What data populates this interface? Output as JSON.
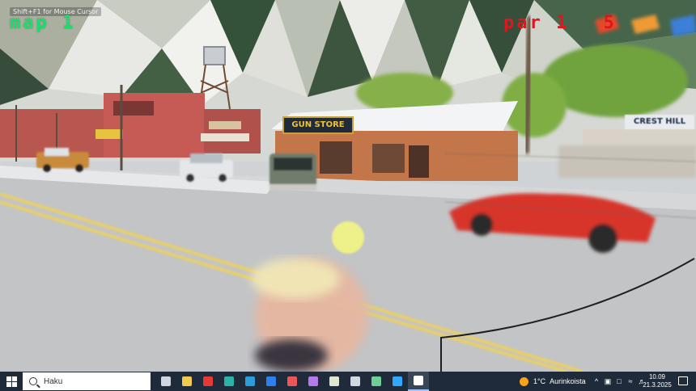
{
  "hud": {
    "map_label": "map 1",
    "par_label": "par 1",
    "strokes_label": "5",
    "hint_text": "Shift+F1 for Mouse Cursor"
  },
  "scene_signs": {
    "gun_store": "GUN STORE",
    "right_building": "CREST HILL"
  },
  "taskbar": {
    "search_placeholder": "Haku",
    "apps": [
      {
        "name": "task-view-icon",
        "color": "#cfd6e0"
      },
      {
        "name": "file-explorer-icon",
        "color": "#f2c94c"
      },
      {
        "name": "red-diamond-app-icon",
        "color": "#e53935"
      },
      {
        "name": "edge-browser-icon",
        "color": "#2ab3a6"
      },
      {
        "name": "waveform-app-icon",
        "color": "#2d9cdb"
      },
      {
        "name": "dropbox-icon",
        "color": "#2f80ed"
      },
      {
        "name": "red-app-icon",
        "color": "#eb5757"
      },
      {
        "name": "copilot-app-icon",
        "color": "#b57be6"
      },
      {
        "name": "calendar-app-icon",
        "color": "#dfe7d0"
      },
      {
        "name": "steam-icon",
        "color": "#d0d8e4"
      },
      {
        "name": "gradient-app-icon",
        "color": "#6fcf97"
      },
      {
        "name": "photoshop-icon",
        "color": "#31a8ff"
      },
      {
        "name": "unreal-engine-icon",
        "color": "#ffffff"
      }
    ],
    "weather_temp": "1°C",
    "weather_text": "Aurinkoista",
    "time": "10.09",
    "date": "21.3.2025"
  },
  "colors": {
    "hud_green": "#17e06a",
    "hud_red": "#e0161e",
    "taskbar_bg": "#1f2b3a"
  }
}
